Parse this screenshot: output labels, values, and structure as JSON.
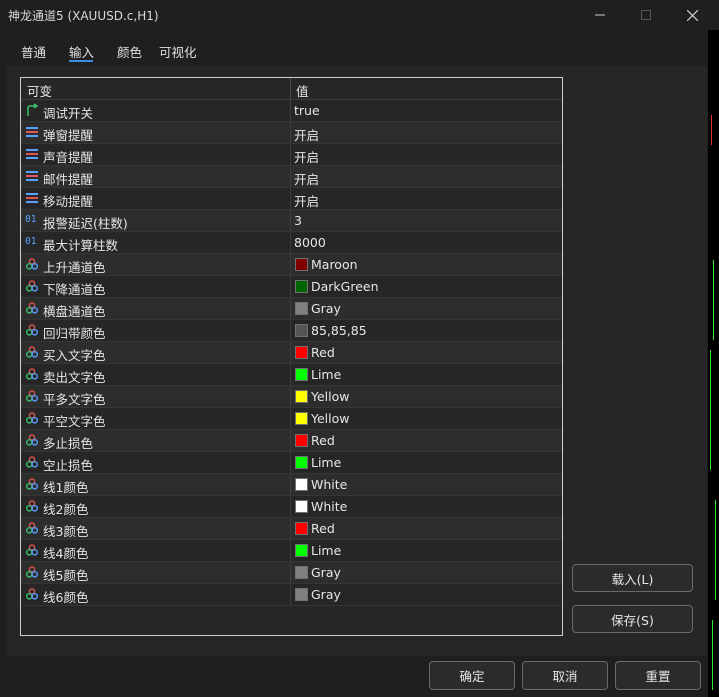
{
  "window": {
    "title": "神龙通道5 (XAUUSD.c,H1)"
  },
  "tabs": [
    {
      "label": "普通"
    },
    {
      "label": "输入",
      "active": true
    },
    {
      "label": "颜色"
    },
    {
      "label": "可视化"
    }
  ],
  "table": {
    "col_variable": "可变",
    "col_value": "值",
    "rows": [
      {
        "icon": "bool-icon",
        "label": "调试开关",
        "value": "true"
      },
      {
        "icon": "enum-icon",
        "label": "弹窗提醒",
        "value": "开启"
      },
      {
        "icon": "enum-icon",
        "label": "声音提醒",
        "value": "开启"
      },
      {
        "icon": "enum-icon",
        "label": "邮件提醒",
        "value": "开启"
      },
      {
        "icon": "enum-icon",
        "label": "移动提醒",
        "value": "开启"
      },
      {
        "icon": "int-icon",
        "icon_text": "01",
        "label": "报警延迟(柱数)",
        "value": "3"
      },
      {
        "icon": "int-icon",
        "icon_text": "01",
        "label": "最大计算柱数",
        "value": "8000"
      },
      {
        "icon": "color-icon",
        "label": "上升通道色",
        "value": "Maroon",
        "swatch": "#800000"
      },
      {
        "icon": "color-icon",
        "label": "下降通道色",
        "value": "DarkGreen",
        "swatch": "#006400"
      },
      {
        "icon": "color-icon",
        "label": "横盘通道色",
        "value": "Gray",
        "swatch": "#808080"
      },
      {
        "icon": "color-icon",
        "label": "回归带颜色",
        "value": "85,85,85",
        "swatch": "#555555"
      },
      {
        "icon": "color-icon",
        "label": "买入文字色",
        "value": "Red",
        "swatch": "#ff0000"
      },
      {
        "icon": "color-icon",
        "label": "卖出文字色",
        "value": "Lime",
        "swatch": "#00ff00"
      },
      {
        "icon": "color-icon",
        "label": "平多文字色",
        "value": "Yellow",
        "swatch": "#ffff00"
      },
      {
        "icon": "color-icon",
        "label": "平空文字色",
        "value": "Yellow",
        "swatch": "#ffff00"
      },
      {
        "icon": "color-icon",
        "label": "多止损色",
        "value": "Red",
        "swatch": "#ff0000"
      },
      {
        "icon": "color-icon",
        "label": "空止损色",
        "value": "Lime",
        "swatch": "#00ff00"
      },
      {
        "icon": "color-icon",
        "label": "线1颜色",
        "value": "White",
        "swatch": "#ffffff"
      },
      {
        "icon": "color-icon",
        "label": "线2颜色",
        "value": "White",
        "swatch": "#ffffff"
      },
      {
        "icon": "color-icon",
        "label": "线3颜色",
        "value": "Red",
        "swatch": "#ff0000"
      },
      {
        "icon": "color-icon",
        "label": "线4颜色",
        "value": "Lime",
        "swatch": "#00ff00"
      },
      {
        "icon": "color-icon",
        "label": "线5颜色",
        "value": "Gray",
        "swatch": "#808080"
      },
      {
        "icon": "color-icon",
        "label": "线6颜色",
        "value": "Gray",
        "swatch": "#808080"
      }
    ]
  },
  "buttons": {
    "load": "载入(L)",
    "save": "保存(S)",
    "ok": "确定",
    "cancel": "取消",
    "reset": "重置"
  },
  "colors": {
    "accent": "#3a8ee6",
    "background": "#1f1f1f",
    "panel": "#262626"
  }
}
